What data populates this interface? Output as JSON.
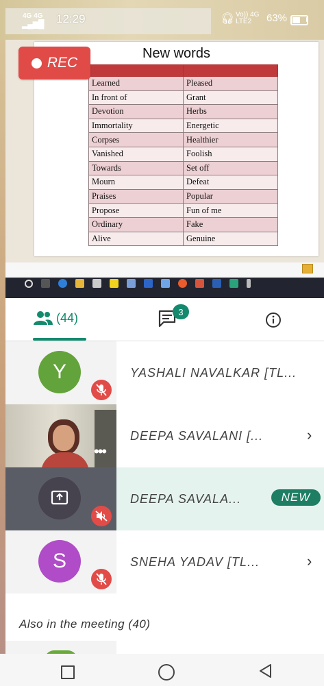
{
  "status_bar": {
    "network_left": "4G  4G",
    "time": "12:29",
    "network_right": "Vo)) 4G\nLTE2",
    "battery_percent": "63%",
    "battery_level": 0.63
  },
  "slide": {
    "title": "New words",
    "rows": [
      [
        "Learned",
        "Pleased"
      ],
      [
        "In front of",
        "Grant"
      ],
      [
        "Devotion",
        "Herbs"
      ],
      [
        "Immortality",
        "Energetic"
      ],
      [
        "Corpses",
        "Healthier"
      ],
      [
        "Vanished",
        "Foolish"
      ],
      [
        "Towards",
        "Set off"
      ],
      [
        "Mourn",
        "Defeat"
      ],
      [
        "Praises",
        "Popular"
      ],
      [
        "Propose",
        "Fun of me"
      ],
      [
        "Ordinary",
        "Fake"
      ],
      [
        "Alive",
        "Genuine"
      ]
    ]
  },
  "rec_badge": "REC",
  "tabs": {
    "participants_count": "(44)",
    "chat_badge": "3"
  },
  "participants": [
    {
      "initial": "Y",
      "name": "YASHALI NAVALKAR [TL...",
      "color": "#63a33b",
      "muted": true
    },
    {
      "initial": "",
      "name": "DEEPA SAVALANI [...",
      "video": true
    },
    {
      "initial": "",
      "name": "DEEPA SAVALA...",
      "badge": "NEW",
      "screen_share": true
    },
    {
      "initial": "S",
      "name": "SNEHA YADAV [TL...",
      "color": "#b04cc7",
      "muted": true
    }
  ],
  "also_in_meeting": "Also in the meeting (40)",
  "colors": {
    "accent": "#138a6e",
    "mute_red": "#e14c48",
    "rec_red": "#e04b48",
    "table_header": "#c0393b"
  }
}
